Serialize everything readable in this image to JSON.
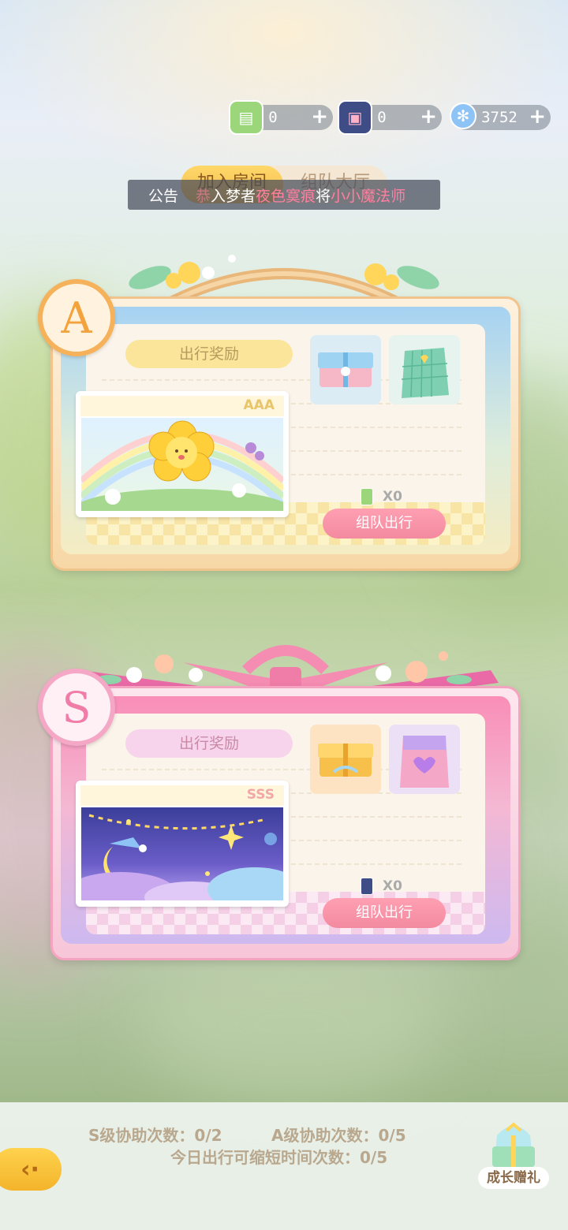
{
  "currencies": [
    {
      "icon": "green-ticket-icon",
      "value": "0",
      "color": "#8fcf6a"
    },
    {
      "icon": "blue-card-icon",
      "value": "0",
      "color": "#4a5a9a"
    },
    {
      "icon": "snowflake-gem-icon",
      "value": "3752",
      "color": "#7fb6f0"
    }
  ],
  "tabs": {
    "join_room": "加入房间",
    "team_hall": "组队大厅"
  },
  "notice": {
    "tag": "公告",
    "prefix": "恭",
    "before": "入梦者",
    "name": "夜色寞痕",
    "middle": "将",
    "item": "小小魔法师"
  },
  "card_a": {
    "grade_letter": "A",
    "reward_label": "出行奖励",
    "ticket_grade": "AAA",
    "count": "X0",
    "button": "组队出行"
  },
  "card_s": {
    "grade_letter": "S",
    "reward_label": "出行奖励",
    "ticket_grade": "SSS",
    "count": "X0",
    "button": "组队出行"
  },
  "bottom": {
    "s_assist": "S级协助次数：0/2",
    "a_assist": "A级协助次数：0/5",
    "shorten": "今日出行可缩短时间次数：0/5",
    "gift_label": "成长赠礼"
  },
  "colors": {
    "accent_yellow": "#f4b94a",
    "accent_pink": "#f38aa0",
    "card_a_frame": "#f7d7a6",
    "card_s_frame": "#f7a6c4"
  }
}
